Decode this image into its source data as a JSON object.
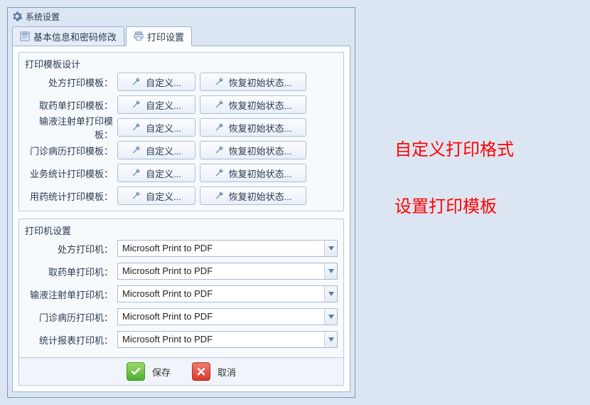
{
  "window": {
    "title": "系统设置"
  },
  "tabs": {
    "basic": "基本信息和密码修改",
    "print": "打印设置"
  },
  "templateSection": {
    "title": "打印模板设计",
    "customLabel": "自定义...",
    "restoreLabel": "恢复初始状态...",
    "rows": [
      "处方打印模板：",
      "取药单打印模板：",
      "输液注射单打印模板：",
      "门诊病历打印模板：",
      "业务统计打印模板：",
      "用药统计打印模板："
    ]
  },
  "printerSection": {
    "title": "打印机设置",
    "rows": [
      {
        "label": "处方打印机：",
        "value": "Microsoft Print to PDF"
      },
      {
        "label": "取药单打印机：",
        "value": "Microsoft Print to PDF"
      },
      {
        "label": "输液注射单打印机：",
        "value": "Microsoft Print to PDF"
      },
      {
        "label": "门诊病历打印机：",
        "value": "Microsoft Print to PDF"
      },
      {
        "label": "统计报表打印机：",
        "value": "Microsoft Print to PDF"
      }
    ]
  },
  "footer": {
    "save": "保存",
    "cancel": "取消"
  },
  "annotations": {
    "line1": "自定义打印格式",
    "line2": "设置打印模板"
  }
}
